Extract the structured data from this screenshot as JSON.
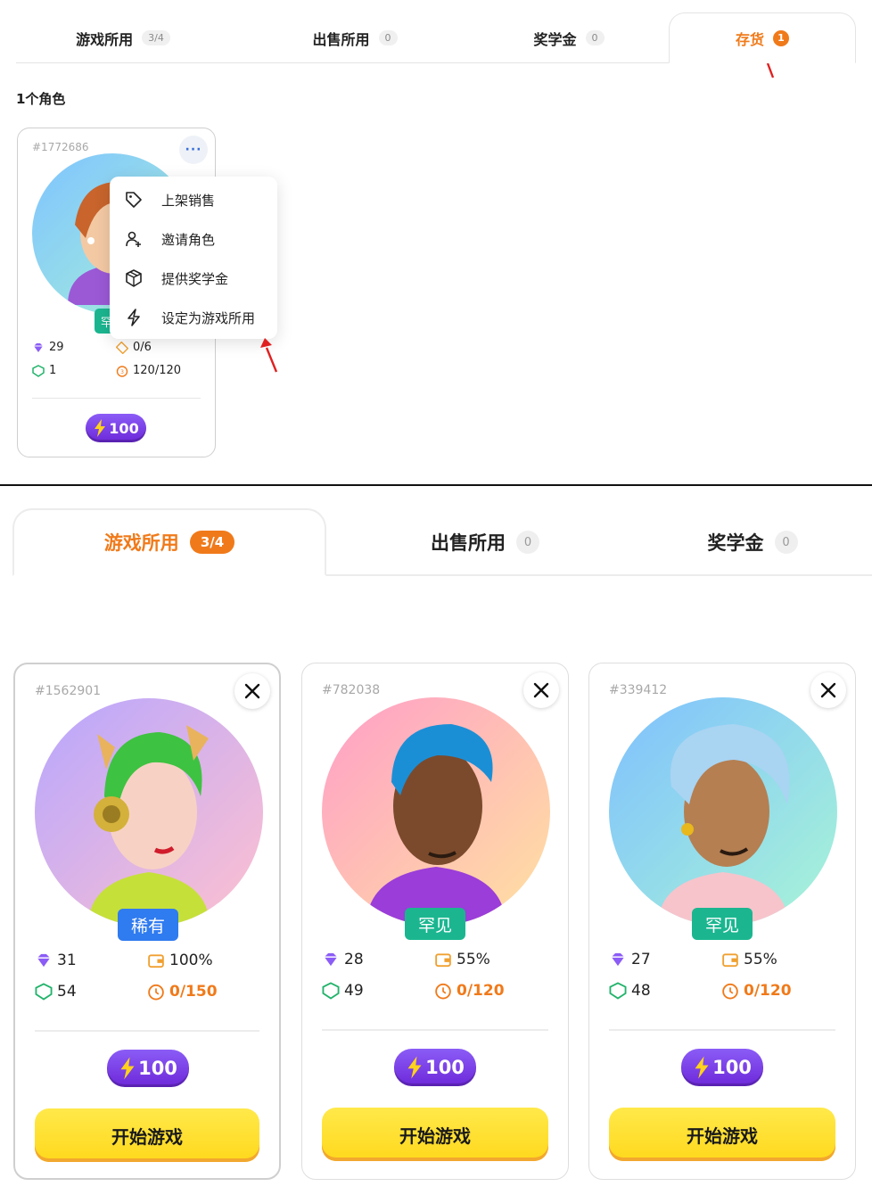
{
  "top": {
    "tabs": [
      {
        "label": "游戏所用",
        "count": "3/4"
      },
      {
        "label": "出售所用",
        "count": "0"
      },
      {
        "label": "奖学金",
        "count": "0"
      },
      {
        "label": "存货",
        "count": "1"
      }
    ],
    "active_tab": "存货",
    "role_count": "1个角色",
    "card": {
      "id": "#1772686",
      "more_label": "···",
      "rarity": "罕见",
      "gems": "29",
      "shield": "1",
      "tickets": "0/6",
      "energy_cap": "120/120",
      "energy": "100"
    },
    "menu": [
      {
        "icon": "tag-icon",
        "label": "上架销售"
      },
      {
        "icon": "user-plus-icon",
        "label": "邀请角色"
      },
      {
        "icon": "box-icon",
        "label": "提供奖学金"
      },
      {
        "icon": "lightning-icon",
        "label": "设定为游戏所用"
      }
    ]
  },
  "bottom": {
    "tabs": [
      {
        "label": "游戏所用",
        "count": "3/4"
      },
      {
        "label": "出售所用",
        "count": "0"
      },
      {
        "label": "奖学金",
        "count": "0"
      }
    ],
    "active_tab": "游戏所用",
    "cards": [
      {
        "id": "#1562901",
        "rarity": "稀有",
        "rarity_color": "#2f7bf0",
        "gems": "31",
        "shield": "54",
        "wallet": "100%",
        "energy_cap": "0/150",
        "energy": "100",
        "play_label": "开始游戏"
      },
      {
        "id": "#782038",
        "rarity": "罕见",
        "rarity_color": "#1bb690",
        "gems": "28",
        "shield": "49",
        "wallet": "55%",
        "energy_cap": "0/120",
        "energy": "100",
        "play_label": "开始游戏"
      },
      {
        "id": "#339412",
        "rarity": "罕见",
        "rarity_color": "#1bb690",
        "gems": "27",
        "shield": "48",
        "wallet": "55%",
        "energy_cap": "0/120",
        "energy": "100",
        "play_label": "开始游戏"
      }
    ]
  },
  "colors": {
    "accent": "#f07a1a",
    "energy": "#7c3aed",
    "play": "#ffdf2e",
    "rare": "#2f7bf0",
    "uncommon": "#1bb690"
  }
}
